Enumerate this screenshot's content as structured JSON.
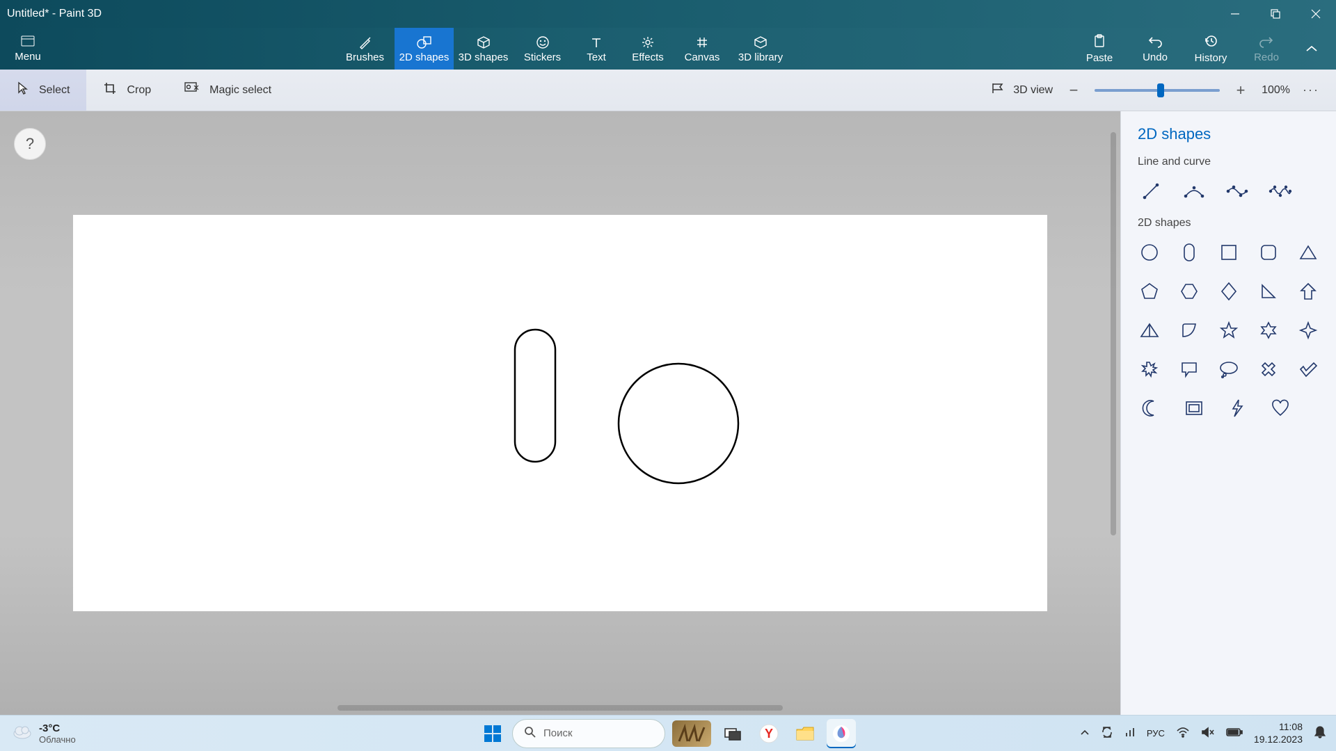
{
  "titlebar": {
    "title": "Untitled* - Paint 3D"
  },
  "ribbon": {
    "menu": "Menu",
    "tabs": {
      "brushes": "Brushes",
      "shapes2d": "2D shapes",
      "shapes3d": "3D shapes",
      "stickers": "Stickers",
      "text": "Text",
      "effects": "Effects",
      "canvas": "Canvas",
      "library3d": "3D library"
    },
    "actions": {
      "paste": "Paste",
      "undo": "Undo",
      "history": "History",
      "redo": "Redo"
    }
  },
  "subbar": {
    "select": "Select",
    "crop": "Crop",
    "magic": "Magic select",
    "view3d": "3D view",
    "zoom": "100%"
  },
  "help": "?",
  "sidebar": {
    "title": "2D shapes",
    "section_line": "Line and curve",
    "section_shapes": "2D shapes"
  },
  "taskbar": {
    "temp": "-3°C",
    "weather": "Облачно",
    "search": "Поиск",
    "lang": "РУС",
    "time": "11:08",
    "date": "19.12.2023"
  }
}
